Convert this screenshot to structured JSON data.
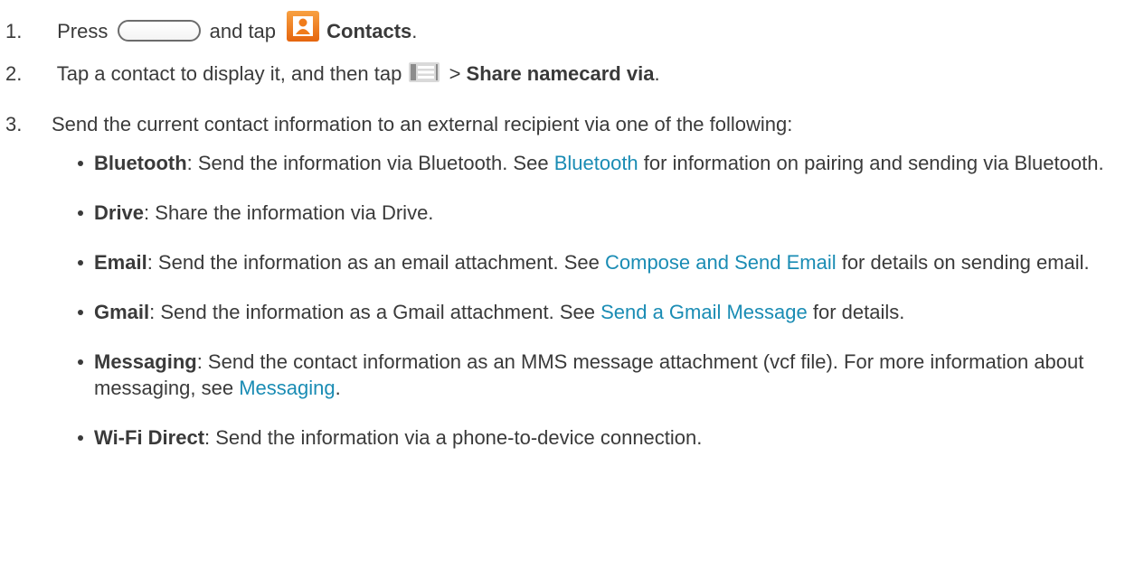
{
  "steps": [
    {
      "number": "1.",
      "text_press": "Press",
      "text_and_tap": "and tap",
      "contacts_label": "Contacts",
      "text_end": ".",
      "icons": [
        "home-key-icon",
        "contacts-app-icon"
      ]
    },
    {
      "number": "2.",
      "text_start": "Tap a contact to display it, and then tap",
      "text_arrow": ">",
      "menu_label": "Share namecard via",
      "text_end": ".",
      "icons": [
        "menu-icon"
      ]
    },
    {
      "number": "3.",
      "text": "Send the current contact information to an external recipient via one of the following:"
    }
  ],
  "options": [
    {
      "label": "Bluetooth",
      "text_before": ": Send the information via Bluetooth. See ",
      "link": "Bluetooth",
      "text_after": " for information on pairing and sending via Bluetooth."
    },
    {
      "label": "Drive",
      "text_before": ": Share the information via Drive.",
      "link": "",
      "text_after": ""
    },
    {
      "label": "Email",
      "text_before": ": Send the information as an email attachment. See ",
      "link": "Compose and Send Email",
      "text_after": " for details on sending email."
    },
    {
      "label": "Gmail",
      "text_before": ": Send the information as a Gmail attachment. See ",
      "link": "Send a Gmail Message",
      "text_after": " for details."
    },
    {
      "label": "Messaging",
      "text_before": ": Send the contact information as an MMS message attachment (vcf file). For more information about messaging, see ",
      "link": "Messaging",
      "text_after": "."
    },
    {
      "label": "Wi-Fi Direct",
      "text_before": ": Send the information via a phone-to-device connection.",
      "link": "",
      "text_after": ""
    }
  ],
  "colors": {
    "text": "#3a3a3a",
    "link": "#1a8cb4",
    "contacts_icon": "#f07c1b"
  }
}
